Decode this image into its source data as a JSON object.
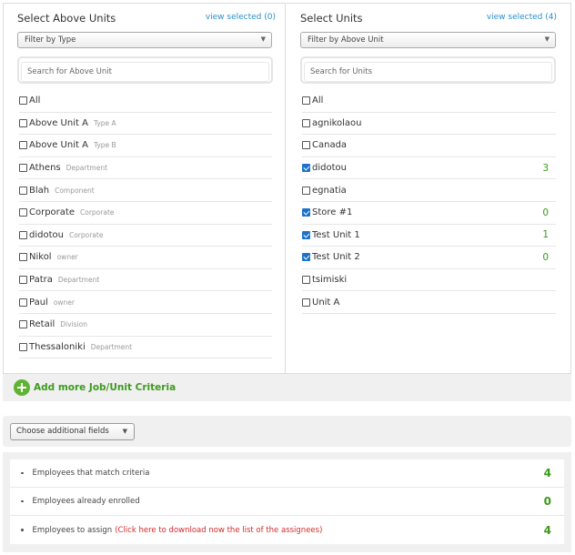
{
  "left_panel": {
    "title": "Select Above Units",
    "view_selected": "view selected (0)",
    "filter": "Filter by Type",
    "search_placeholder": "Search for Above Unit",
    "items": [
      {
        "label": "All",
        "type": "",
        "checked": false
      },
      {
        "label": "Above Unit A",
        "type": "Type A",
        "checked": false
      },
      {
        "label": "Above Unit A",
        "type": "Type B",
        "checked": false
      },
      {
        "label": "Athens",
        "type": "Department",
        "checked": false
      },
      {
        "label": "Blah",
        "type": "Component",
        "checked": false
      },
      {
        "label": "Corporate",
        "type": "Corporate",
        "checked": false
      },
      {
        "label": "didotou",
        "type": "Corporate",
        "checked": false
      },
      {
        "label": "Nikol",
        "type": "owner",
        "checked": false
      },
      {
        "label": "Patra",
        "type": "Department",
        "checked": false
      },
      {
        "label": "Paul",
        "type": "owner",
        "checked": false
      },
      {
        "label": "Retail",
        "type": "Division",
        "checked": false
      },
      {
        "label": "Thessaloniki",
        "type": "Department",
        "checked": false
      }
    ]
  },
  "right_panel": {
    "title": "Select Units",
    "view_selected": "view selected (4)",
    "filter": "Filter by Above Unit",
    "search_placeholder": "Search for Units",
    "items": [
      {
        "label": "All",
        "checked": false,
        "count": ""
      },
      {
        "label": "agnikolaou",
        "checked": false,
        "count": ""
      },
      {
        "label": "Canada",
        "checked": false,
        "count": ""
      },
      {
        "label": "didotou",
        "checked": true,
        "count": "3"
      },
      {
        "label": "egnatia",
        "checked": false,
        "count": ""
      },
      {
        "label": "Store #1",
        "checked": true,
        "count": "0"
      },
      {
        "label": "Test Unit 1",
        "checked": true,
        "count": "1"
      },
      {
        "label": "Test Unit 2",
        "checked": true,
        "count": "0"
      },
      {
        "label": "tsimiski",
        "checked": false,
        "count": ""
      },
      {
        "label": "Unit A",
        "checked": false,
        "count": ""
      }
    ]
  },
  "add_criteria": {
    "label": "Add more Job/Unit Criteria",
    "icon": "plus-circle-icon"
  },
  "additional_fields": {
    "label": "Choose additional fields"
  },
  "summary": [
    {
      "label": "Employees that match criteria",
      "link": "",
      "count": "4"
    },
    {
      "label": "Employees already enrolled",
      "link": "",
      "count": "0"
    },
    {
      "label": "Employees to assign",
      "link": "(Click here to download now the list of the assignees)",
      "count": "4"
    }
  ],
  "colors": {
    "accent_green": "#3a9a1a",
    "link_blue": "#2a8fc7",
    "link_red": "#d42b2b",
    "checkbox_blue": "#1e73c8"
  }
}
